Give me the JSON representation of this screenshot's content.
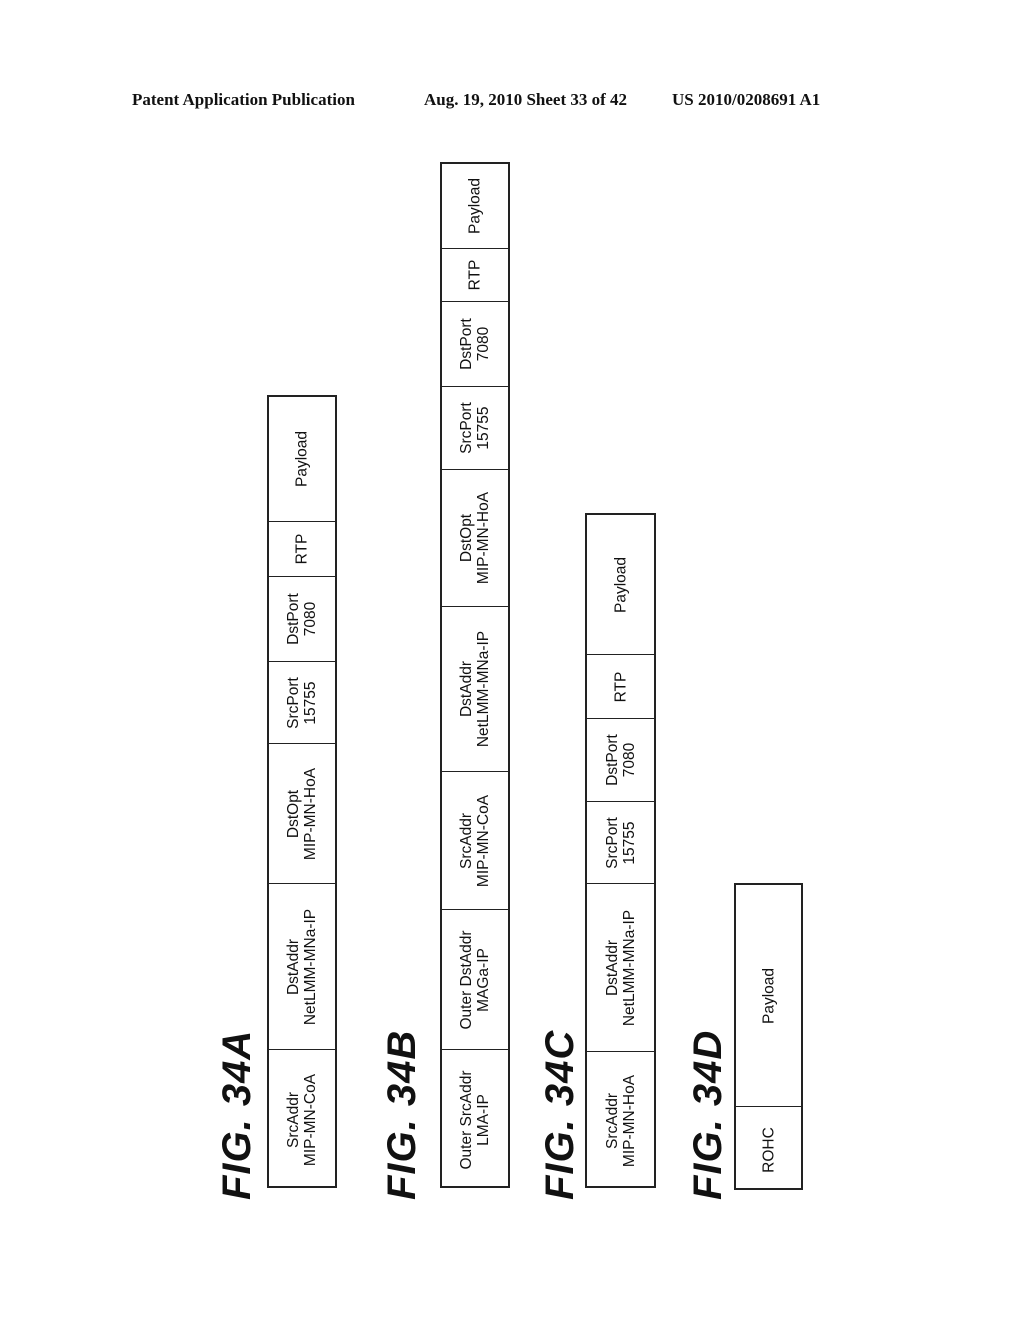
{
  "header": {
    "publication": "Patent Application Publication",
    "date_sheet": "Aug. 19, 2010  Sheet 33 of 42",
    "patent_number": "US 2010/0208691 A1"
  },
  "figures": [
    {
      "label": "FIG. 34A",
      "fields": [
        {
          "line1": "SrcAddr",
          "line2": "MIP-MN-CoA"
        },
        {
          "line1": "DstAddr",
          "line2": "NetLMM-MNa-IP"
        },
        {
          "line1": "DstOpt",
          "line2": "MIP-MN-HoA"
        },
        {
          "line1": "SrcPort",
          "line2": "15755"
        },
        {
          "line1": "DstPort",
          "line2": "7080"
        },
        {
          "line1": "RTP",
          "line2": ""
        },
        {
          "line1": "Payload",
          "line2": ""
        }
      ]
    },
    {
      "label": "FIG. 34B",
      "fields": [
        {
          "line1": "Outer SrcAddr",
          "line2": "LMA-IP"
        },
        {
          "line1": "Outer DstAddr",
          "line2": "MAGa-IP"
        },
        {
          "line1": "SrcAddr",
          "line2": "MIP-MN-CoA"
        },
        {
          "line1": "DstAddr",
          "line2": "NetLMM-MNa-IP"
        },
        {
          "line1": "DstOpt",
          "line2": "MIP-MN-HoA"
        },
        {
          "line1": "SrcPort",
          "line2": "15755"
        },
        {
          "line1": "DstPort",
          "line2": "7080"
        },
        {
          "line1": "RTP",
          "line2": ""
        },
        {
          "line1": "Payload",
          "line2": ""
        }
      ]
    },
    {
      "label": "FIG. 34C",
      "fields": [
        {
          "line1": "SrcAddr",
          "line2": "MIP-MN-HoA"
        },
        {
          "line1": "DstAddr",
          "line2": "NetLMM-MNa-IP"
        },
        {
          "line1": "SrcPort",
          "line2": "15755"
        },
        {
          "line1": "DstPort",
          "line2": "7080"
        },
        {
          "line1": "RTP",
          "line2": ""
        },
        {
          "line1": "Payload",
          "line2": ""
        }
      ]
    },
    {
      "label": "FIG. 34D",
      "fields": [
        {
          "line1": "ROHC",
          "line2": ""
        },
        {
          "line1": "Payload",
          "line2": ""
        }
      ]
    }
  ]
}
